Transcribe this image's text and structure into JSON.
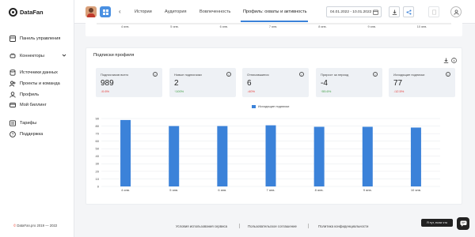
{
  "app": {
    "name": "DataFan"
  },
  "sidebar": {
    "items": [
      {
        "label": "Панель управления",
        "icon": "dashboard-icon"
      },
      {
        "label": "Коннекторы",
        "icon": "plug-icon"
      },
      {
        "label": "Источники данных",
        "icon": "database-icon"
      },
      {
        "label": "Проекты и команда",
        "icon": "team-icon"
      },
      {
        "label": "Профиль",
        "icon": "user-icon"
      },
      {
        "label": "Мой биллинг",
        "icon": "billing-icon"
      },
      {
        "label": "Тарифы",
        "icon": "tariffs-icon"
      },
      {
        "label": "Поддержка",
        "icon": "help-icon"
      }
    ],
    "footer": "DataFan.pro 2019 — 2022",
    "footer_symbol": "©"
  },
  "header": {
    "tabs": [
      {
        "label": "Истории"
      },
      {
        "label": "Аудитория"
      },
      {
        "label": "Вовлеченность"
      },
      {
        "label": "Профиль: охваты и активность"
      }
    ],
    "active_tab": 3,
    "date_range": "04.01.2022 - 10.01.2022"
  },
  "prev_chart": {
    "ticks": [
      "4 янв.",
      "5 янв.",
      "6 янв.",
      "7 янв.",
      "8 янв.",
      "9 янв.",
      "10 янв."
    ]
  },
  "card": {
    "title": "Подписки профиля",
    "stats": [
      {
        "label": "Подписчиков всего",
        "value": "989",
        "change": "0.6%",
        "dir": "down"
      },
      {
        "label": "Новые подписчики",
        "value": "2",
        "change": "100%",
        "dir": "up"
      },
      {
        "label": "Отписавшиеся",
        "value": "6",
        "change": "40%",
        "dir": "down"
      },
      {
        "label": "Прирост за период",
        "value": "-4",
        "change": "55.6%",
        "dir": "up"
      },
      {
        "label": "Исходящие подписки",
        "value": "77",
        "change": "12.5%",
        "dir": "down"
      }
    ]
  },
  "chart_data": {
    "type": "bar",
    "categories": [
      "4 янв.",
      "5 янв.",
      "6 янв.",
      "7 янв.",
      "8 янв.",
      "9 янв.",
      "10 янв."
    ],
    "series": [
      {
        "name": "Исходящие подписки",
        "values": [
          88,
          80,
          80,
          81,
          79,
          79,
          78
        ],
        "color": "#3b82d9"
      }
    ],
    "ylim": [
      0,
      90
    ],
    "yticks": [
      0,
      10,
      20,
      30,
      40,
      50,
      60,
      70,
      80,
      90
    ],
    "grid": true,
    "legend": "top-center"
  },
  "footer": {
    "links": [
      "Условия использования сервиса",
      "Пользовательское соглашение",
      "Политика конфиденциальности"
    ]
  },
  "tooltip": {
    "text": "Я тут, если что"
  },
  "colors": {
    "accent": "#3b82d9",
    "negative": "#e53935",
    "positive": "#43a047"
  }
}
